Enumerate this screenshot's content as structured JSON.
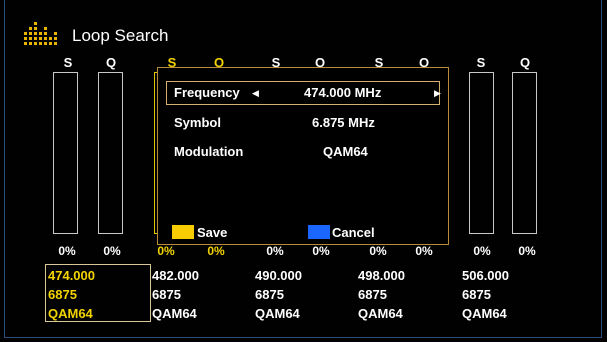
{
  "window": {
    "title": "Loop Search",
    "icon": "equalizer-icon",
    "accent": "#f3d400"
  },
  "signal_columns": [
    {
      "label": "S",
      "percent": "0%",
      "level": 0,
      "highlighted": false
    },
    {
      "label": "Q",
      "percent": "0%",
      "level": 0,
      "highlighted": false
    },
    {
      "label": "S",
      "percent": "0%",
      "level": 0,
      "highlighted": true
    },
    {
      "label": "Q",
      "percent": "0%",
      "level": 0,
      "highlighted": true
    },
    {
      "label": "S",
      "percent": "0%",
      "level": 0,
      "highlighted": false
    },
    {
      "label": "Q",
      "percent": "0%",
      "level": 0,
      "highlighted": false
    },
    {
      "label": "S",
      "percent": "0%",
      "level": 0,
      "highlighted": false
    },
    {
      "label": "Q",
      "percent": "0%",
      "level": 0,
      "highlighted": false
    },
    {
      "label": "S",
      "percent": "0%",
      "level": 0,
      "highlighted": false
    },
    {
      "label": "Q",
      "percent": "0%",
      "level": 0,
      "highlighted": false
    }
  ],
  "channels": [
    {
      "frequency": "474.000",
      "symbol": "6875",
      "modulation": "QAM64",
      "selected": true
    },
    {
      "frequency": "482.000",
      "symbol": "6875",
      "modulation": "QAM64",
      "selected": false
    },
    {
      "frequency": "490.000",
      "symbol": "6875",
      "modulation": "QAM64",
      "selected": false
    },
    {
      "frequency": "498.000",
      "symbol": "6875",
      "modulation": "QAM64",
      "selected": false
    },
    {
      "frequency": "506.000",
      "symbol": "6875",
      "modulation": "QAM64",
      "selected": false
    }
  ],
  "dialog": {
    "frequency": {
      "label": "Frequency",
      "value": "474.000 MHz",
      "left_arrow": "left-arrow-icon",
      "right_arrow": "right-arrow-icon"
    },
    "symbol": {
      "label": "Symbol",
      "value": "6.875 MHz"
    },
    "modulation": {
      "label": "Modulation",
      "value": "QAM64"
    },
    "save": {
      "label": "Save",
      "color": "#f7cc00"
    },
    "cancel": {
      "label": "Cancel",
      "color": "#1a66ff"
    }
  }
}
